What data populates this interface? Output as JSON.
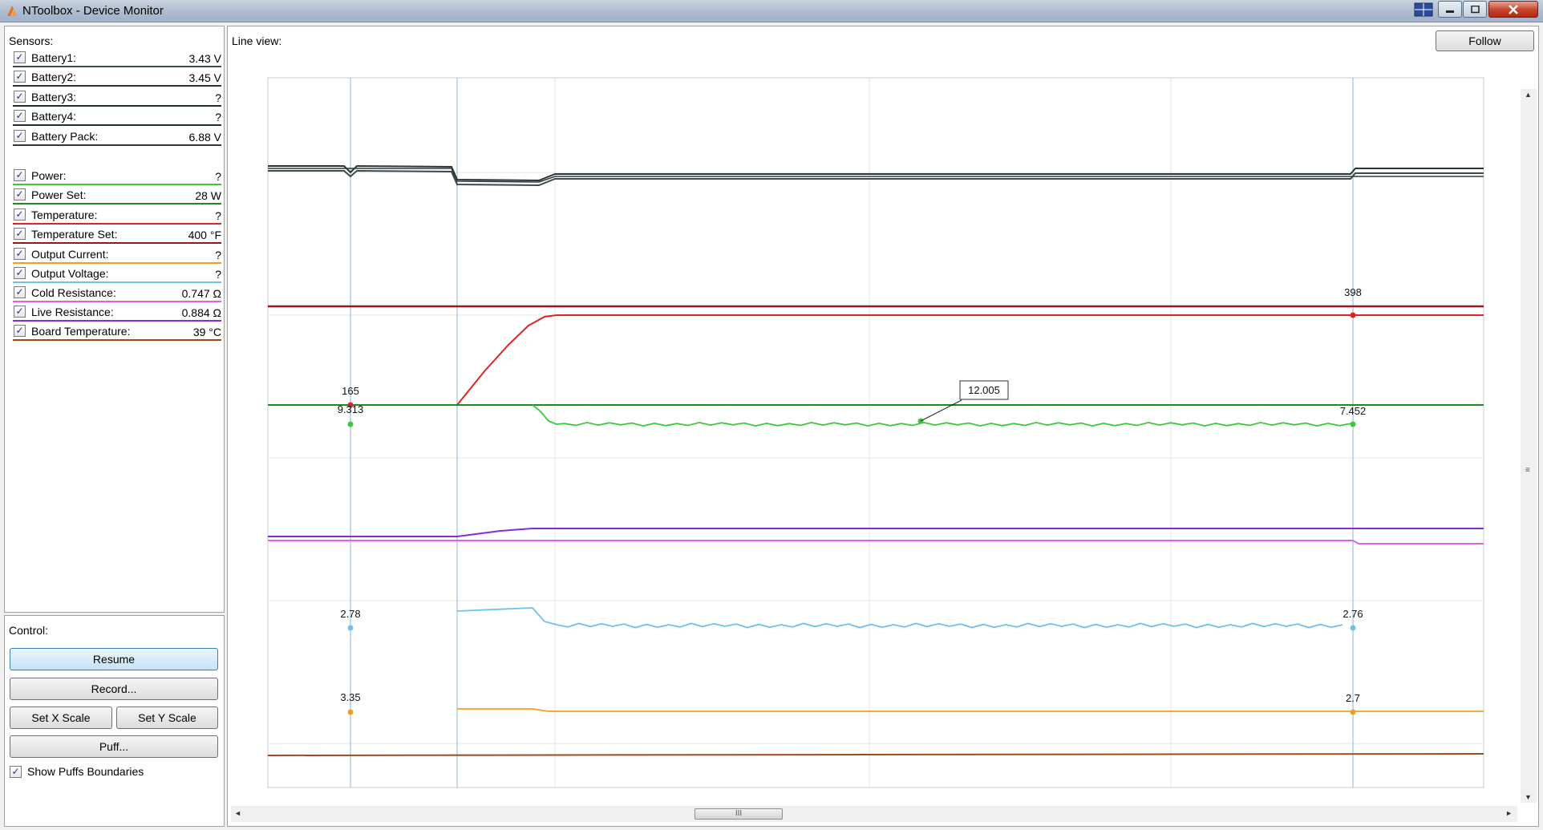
{
  "window": {
    "title": "NToolbox - Device Monitor",
    "icons": [
      "app-logo-icon",
      "layout-grid-icon",
      "minimize-icon",
      "maximize-icon",
      "close-icon"
    ]
  },
  "sensors": {
    "title": "Sensors:",
    "items": [
      {
        "label": "Battery1:",
        "value": "3.43 V",
        "checked": true,
        "color": "#3d4a50"
      },
      {
        "label": "Battery2:",
        "value": "3.45 V",
        "checked": true,
        "color": "#2b3538"
      },
      {
        "label": "Battery3:",
        "value": "?",
        "checked": true,
        "color": "#203030"
      },
      {
        "label": "Battery4:",
        "value": "?",
        "checked": true,
        "color": "#203030"
      },
      {
        "label": "Battery Pack:",
        "value": "6.88 V",
        "checked": true,
        "color": "#2e3a3a"
      },
      {
        "label": "Power:",
        "value": "?",
        "checked": true,
        "color": "#3ec63e"
      },
      {
        "label": "Power Set:",
        "value": "28 W",
        "checked": true,
        "color": "#1d8a1d"
      },
      {
        "label": "Temperature:",
        "value": "?",
        "checked": true,
        "color": "#e02424"
      },
      {
        "label": "Temperature Set:",
        "value": "400 °F",
        "checked": true,
        "color": "#9a1818"
      },
      {
        "label": "Output Current:",
        "value": "?",
        "checked": true,
        "color": "#f0a020"
      },
      {
        "label": "Output Voltage:",
        "value": "?",
        "checked": true,
        "color": "#6ec0ee"
      },
      {
        "label": "Cold Resistance:",
        "value": "0.747 Ω",
        "checked": true,
        "color": "#e060e0"
      },
      {
        "label": "Live Resistance:",
        "value": "0.884 Ω",
        "checked": true,
        "color": "#8a2ad6"
      },
      {
        "label": "Board Temperature:",
        "value": "39 °C",
        "checked": true,
        "color": "#a04a18"
      }
    ]
  },
  "control": {
    "title": "Control:",
    "resume": "Resume",
    "record": "Record...",
    "set_x_scale": "Set X Scale",
    "set_y_scale": "Set Y Scale",
    "puff": "Puff...",
    "show_puffs_label": "Show Puffs Boundaries",
    "show_puffs_checked": true
  },
  "line_view": {
    "title": "Line view:",
    "follow": "Follow",
    "scroll_grip": "III",
    "marker_labels": {
      "temp_set_right": "398",
      "power_left_top": "165",
      "power_left": "9.313",
      "power_tooltip": "12.005",
      "power_right": "7.452",
      "voltage_left": "2.78",
      "voltage_right": "2.76",
      "current_left": "3.35",
      "current_right": "2.7"
    }
  }
}
